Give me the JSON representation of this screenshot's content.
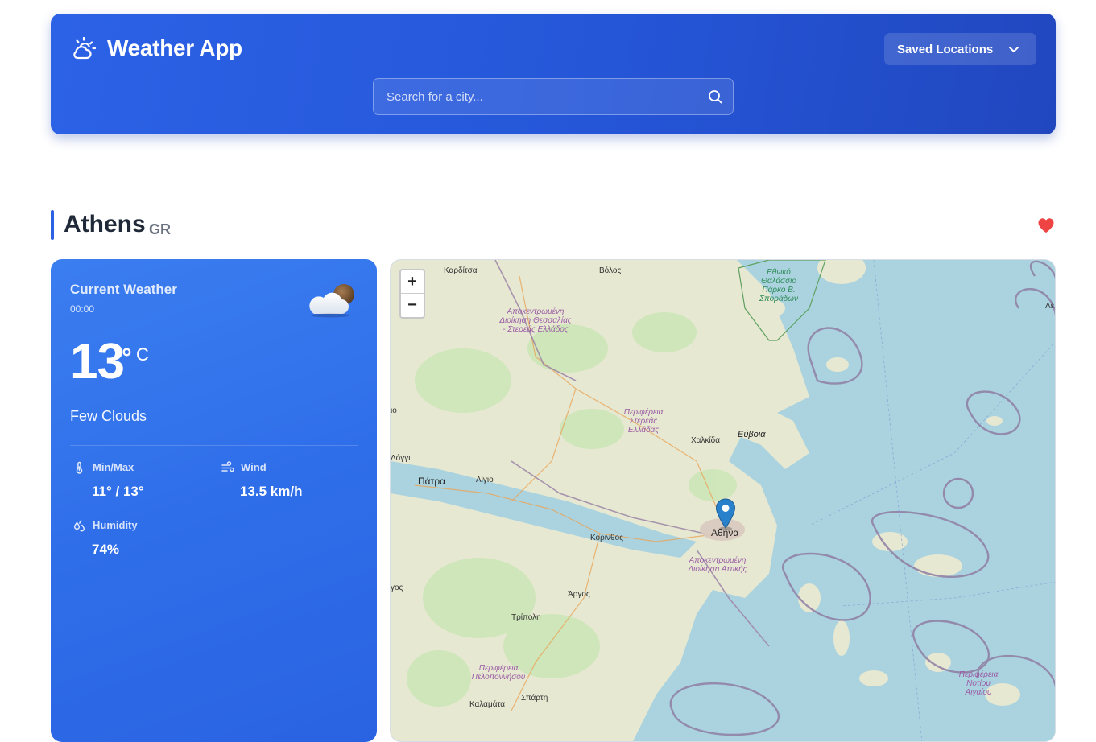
{
  "header": {
    "app_title": "Weather App",
    "saved_locations_label": "Saved Locations",
    "search_placeholder": "Search for a city..."
  },
  "location": {
    "city": "Athens",
    "country": "GR"
  },
  "current": {
    "title": "Current Weather",
    "time": "00:00",
    "temp": "13",
    "deg": "°",
    "unit": "C",
    "description": "Few Clouds",
    "minmax_label": "Min/Max",
    "minmax_value": "11° / 13°",
    "wind_label": "Wind",
    "wind_value": "13.5 km/h",
    "humidity_label": "Humidity",
    "humidity_value": "74%"
  },
  "map": {
    "zoom_in": "+",
    "zoom_out": "−",
    "labels": {
      "karditsa": "Καρδίτσα",
      "volos": "Βόλος",
      "thessaly": "Αποκεντρωμένη Διοίκηση Θεσσαλίας - Στερεάς Ελλάδος",
      "park": "Εθνικό Θαλάσσιο Πάρκο Β. Σποράδων",
      "sterea": "Περιφέρεια Στερεάς Ελλάδας",
      "chalkida": "Χαλκίδα",
      "evia": "Εύβοια",
      "patra": "Πάτρα",
      "aigio": "Αίγιο",
      "korinthos": "Κόρινθος",
      "athina": "Αθήνα",
      "attica": "Αποκεντρωμένη Διοίκηση Αττικής",
      "argos": "Άργος",
      "tripoli": "Τρίπολη",
      "peloponnese": "Περιφέρεια Πελοποννήσου",
      "sparti": "Σπάρτη",
      "kalamata": "Καλαμάτα",
      "south_aegean": "Περιφέρεια Νοτίου Αιγαίου",
      "edge_lo": "ιο",
      "edge_ougi": "Λόγγι",
      "edge_ogos": "γος",
      "edge_le": "Λέ"
    }
  },
  "colors": {
    "primary": "#2c62e6",
    "card": "#3171ea",
    "favorite": "#ef4444",
    "sea": "#aad3df",
    "land": "#f2efe9"
  },
  "icons": {
    "brand": "sun-cloud-icon",
    "chevron": "chevron-down-icon",
    "search": "search-icon",
    "favorite": "heart-icon",
    "weather": "few-clouds-night-icon",
    "minmax": "thermometer-icon",
    "wind": "wind-icon",
    "humidity": "droplets-icon",
    "marker": "map-pin-icon"
  }
}
